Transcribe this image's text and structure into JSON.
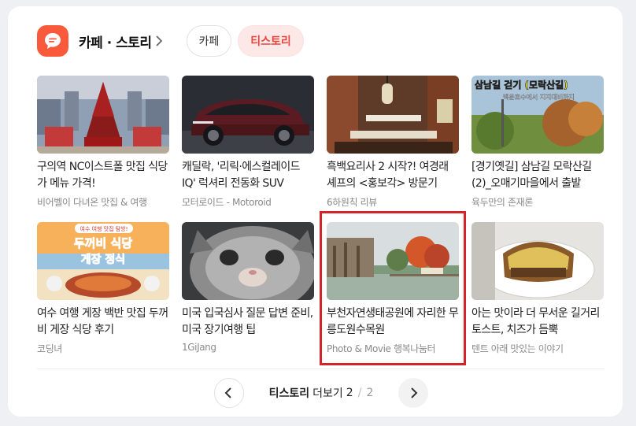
{
  "header": {
    "title": "카페 · 스토리",
    "tabs": [
      {
        "label": "카페",
        "active": false
      },
      {
        "label": "티스토리",
        "active": true
      }
    ]
  },
  "items": [
    {
      "title": "구의역 NC이스트폴 맛집 식당가 메뉴 가격!",
      "source": "비어벨이 다녀온 맛집 & 여행"
    },
    {
      "title": "캐딜락, '리릭·에스컬레이드 IQ' 럭셔리 전동화 SUV",
      "source": "모터로이드 - Motoroid"
    },
    {
      "title": "흑백요리사 2 시작?! 여경래 셰프의 <홍보각> 방문기",
      "source": "6하원칙 리뷰"
    },
    {
      "title": "[경기옛길] 삼남길 모락산길(2)_오매기마을에서 출발",
      "source": "육두만의 존재론"
    },
    {
      "title": "여수 여행 게장 백반 맛집 두꺼비 게장 식당 후기",
      "source": "코딩녀"
    },
    {
      "title": "미국 입국심사 질문 답변 준비, 미국 장기여행 팁",
      "source": "1GiJang"
    },
    {
      "title": "부천자연생태공원에 자리한 무릉도원수목원",
      "source": "Photo & Movie 행복나눔터"
    },
    {
      "title": "아는 맛이라 더 무서운 길거리토스트, 치즈가 듬뿍",
      "source": "텐트 아래 맛있는 이야기"
    }
  ],
  "thumb_text": {
    "item4": "삼남길 걷기 (모락산길)",
    "item4_sub": "백운호수에서 지지대비까지",
    "item5_top": "여수 여행 맛집 탐방!",
    "item5_main1": "두꺼비 식당",
    "item5_main2": "게장 정식"
  },
  "pager": {
    "label": "티스토리",
    "suffix": "더보기",
    "current": "2",
    "total": "2"
  },
  "colors": {
    "brand": "#fa5a3c",
    "active_tab_bg": "#fde8e8",
    "active_tab_text": "#e8453c",
    "highlight": "#d6232a"
  }
}
